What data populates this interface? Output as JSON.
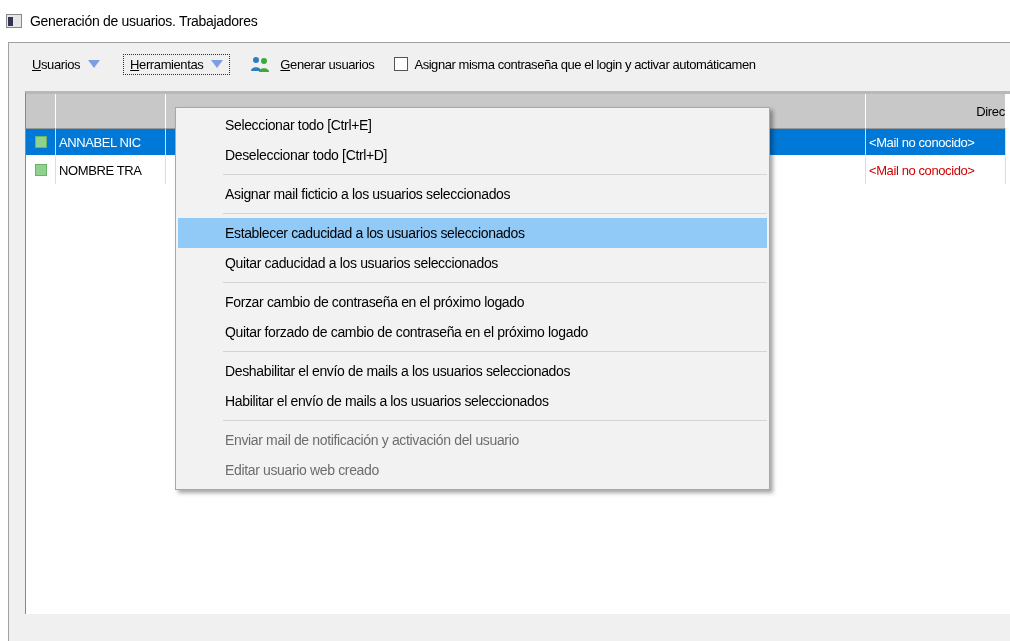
{
  "window": {
    "title": "Generación de usuarios. Trabajadores"
  },
  "toolbar": {
    "menus": [
      {
        "label": "Usuarios",
        "selected": false
      },
      {
        "label": "Herramientas",
        "selected": true
      }
    ],
    "generate_button": "Generar usuarios",
    "checkbox": {
      "label": "Asignar misma contraseña que el login y activar automáticamen",
      "checked": false
    }
  },
  "table": {
    "columns": [
      "Direc"
    ],
    "rows": [
      {
        "name": "ANNABEL NIC",
        "email": "<Mail no conocido>",
        "selected": true
      },
      {
        "name": "NOMBRE TRA",
        "email": "<Mail no conocido>",
        "selected": false
      }
    ]
  },
  "dropdown_menu": {
    "items": [
      {
        "kind": "item",
        "label": "Seleccionar todo  [Ctrl+E]",
        "disabled": false,
        "selected": false
      },
      {
        "kind": "item",
        "label": "Deseleccionar todo  [Ctrl+D]",
        "disabled": false,
        "selected": false
      },
      {
        "kind": "separator"
      },
      {
        "kind": "item",
        "label": "Asignar mail ficticio a los usuarios seleccionados",
        "disabled": false,
        "selected": false
      },
      {
        "kind": "separator"
      },
      {
        "kind": "item",
        "label": "Establecer caducidad a los usuarios seleccionados",
        "disabled": false,
        "selected": true
      },
      {
        "kind": "item",
        "label": "Quitar caducidad a los usuarios seleccionados",
        "disabled": false,
        "selected": false
      },
      {
        "kind": "separator"
      },
      {
        "kind": "item",
        "label": "Forzar cambio de contraseña en el próximo logado",
        "disabled": false,
        "selected": false
      },
      {
        "kind": "item",
        "label": "Quitar forzado de cambio de contraseña en el próximo logado",
        "disabled": false,
        "selected": false
      },
      {
        "kind": "separator"
      },
      {
        "kind": "item",
        "label": "Deshabilitar el envío de mails a los usuarios seleccionados",
        "disabled": false,
        "selected": false
      },
      {
        "kind": "item",
        "label": "Habilitar el envío de mails a los usuarios seleccionados",
        "disabled": false,
        "selected": false
      },
      {
        "kind": "separator"
      },
      {
        "kind": "item",
        "label": "Enviar mail de notificación y activación del usuario",
        "disabled": true,
        "selected": false
      },
      {
        "kind": "item",
        "label": "Editar usuario web creado",
        "disabled": true,
        "selected": false
      }
    ]
  }
}
